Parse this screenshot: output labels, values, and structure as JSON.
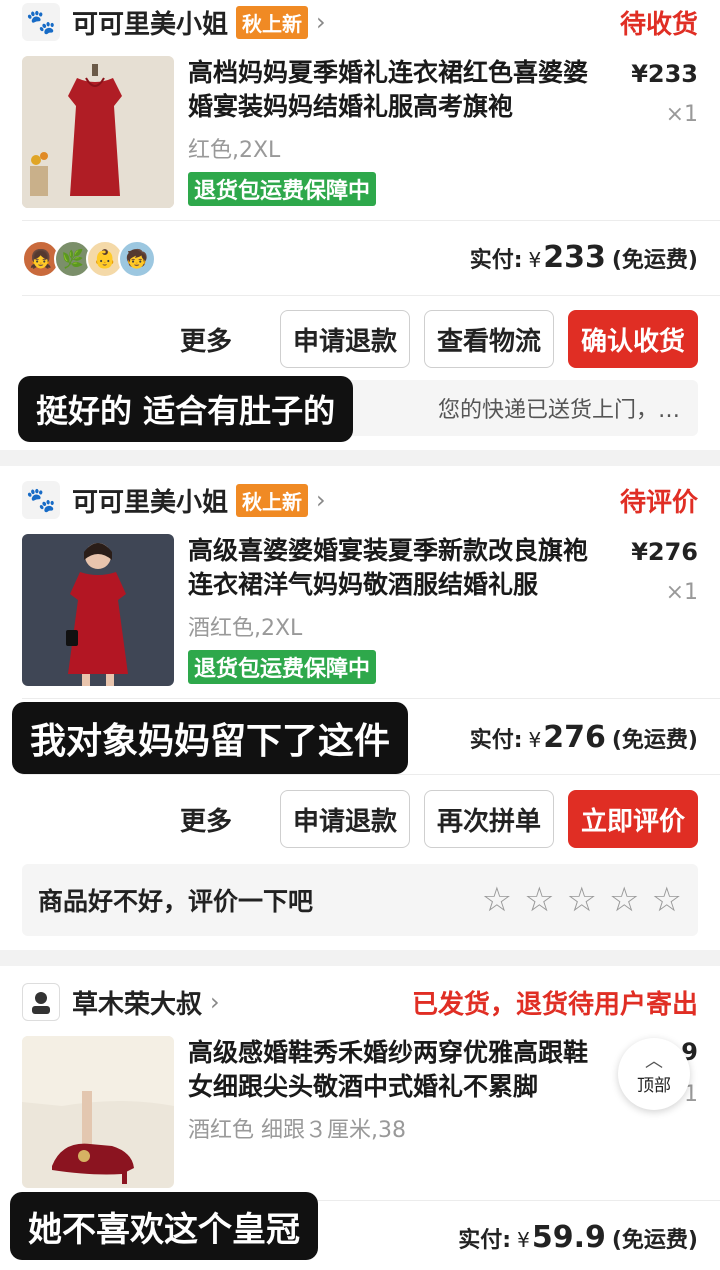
{
  "orders": [
    {
      "shop": "可可里美小姐",
      "tag": "秋上新",
      "status": "待收货",
      "title": "高档妈妈夏季婚礼连衣裙红色喜婆婆婚宴装妈妈结婚礼服高考旗袍",
      "spec": "红色,2XL",
      "guarantee": "退货包运费保障中",
      "price": "¥233",
      "qty": "×1",
      "paid_label": "实付:",
      "currency": "¥",
      "paid_value": "233",
      "freight": "(免运费)",
      "more": "更多",
      "buttons": [
        "申请退款",
        "查看物流",
        "确认收货"
      ],
      "notice": "您的快递已送货上门，…"
    },
    {
      "shop": "可可里美小姐",
      "tag": "秋上新",
      "status": "待评价",
      "title": "高级喜婆婆婚宴装夏季新款改良旗袍连衣裙洋气妈妈敬酒服结婚礼服",
      "spec": "酒红色,2XL",
      "guarantee": "退货包运费保障中",
      "price": "¥276",
      "qty": "×1",
      "paid_label": "实付:",
      "currency": "¥",
      "paid_value": "276",
      "freight": "(免运费)",
      "more": "更多",
      "buttons": [
        "申请退款",
        "再次拼单",
        "立即评价"
      ],
      "rate_prompt": "商品好不好，评价一下吧",
      "stars": 5
    },
    {
      "shop": "草木荣大叔",
      "status": "已发货，退货待用户寄出",
      "title": "高级感婚鞋秀禾婚纱两穿优雅高跟鞋女细跟尖头敬酒中式婚礼不累脚",
      "spec": "酒红色 细跟３厘米,38",
      "price": "9",
      "qty": "1",
      "paid_label": "实付:",
      "currency": "¥",
      "paid_value": "59.9",
      "freight": "(免运费)"
    }
  ],
  "overlays": [
    "挺好的 适合有肚子的",
    "我对象妈妈留下了这件",
    "她不喜欢这个皇冠"
  ],
  "top_button": "顶部",
  "colors": {
    "accent": "#e02e24",
    "guarantee": "#2ea84b",
    "tag": "#f08a24"
  }
}
